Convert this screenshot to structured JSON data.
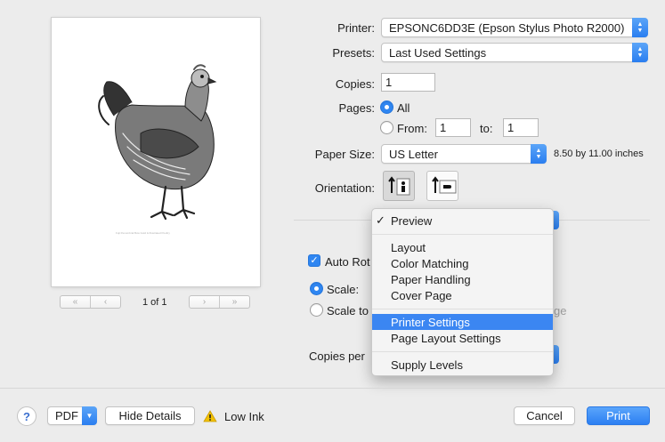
{
  "preview": {
    "caption": "Fuji Penumbral Bow Gold & Illustrated Poultry",
    "page_count": "1 of 1",
    "nav_first": "«",
    "nav_prev": "‹",
    "nav_next": "›",
    "nav_last": "»"
  },
  "printer": {
    "label": "Printer:",
    "value": "EPSONC6DD3E (Epson Stylus Photo R2000)"
  },
  "presets": {
    "label": "Presets:",
    "value": "Last Used Settings"
  },
  "copies": {
    "label": "Copies:",
    "value": "1"
  },
  "pages": {
    "label": "Pages:",
    "all_label": "All",
    "from_label": "From:",
    "from_value": "1",
    "to_label": "to:",
    "to_value": "1",
    "selected": "All"
  },
  "paper_size": {
    "label": "Paper Size:",
    "value": "US Letter",
    "dimensions": "8.50 by 11.00 inches"
  },
  "orientation": {
    "label": "Orientation:",
    "selected": "portrait"
  },
  "partial": {
    "auto_rotate": "Auto Rot",
    "scale": "Scale:",
    "scale_to": "Scale to",
    "copies_per": "Copies per",
    "hidden_suffix": "ge"
  },
  "menu": {
    "checked_item": "Preview",
    "highlighted_item": "Printer Settings",
    "items": [
      "Preview",
      "Layout",
      "Color Matching",
      "Paper Handling",
      "Cover Page",
      "Printer Settings",
      "Page Layout Settings",
      "Supply Levels"
    ]
  },
  "bottom": {
    "help": "?",
    "pdf": "PDF",
    "hide_details": "Hide Details",
    "warning": "Low Ink",
    "cancel": "Cancel",
    "print": "Print"
  },
  "colors": {
    "accent": "#2f86f1",
    "highlight": "#3b86f2",
    "warning": "#f2c100"
  }
}
